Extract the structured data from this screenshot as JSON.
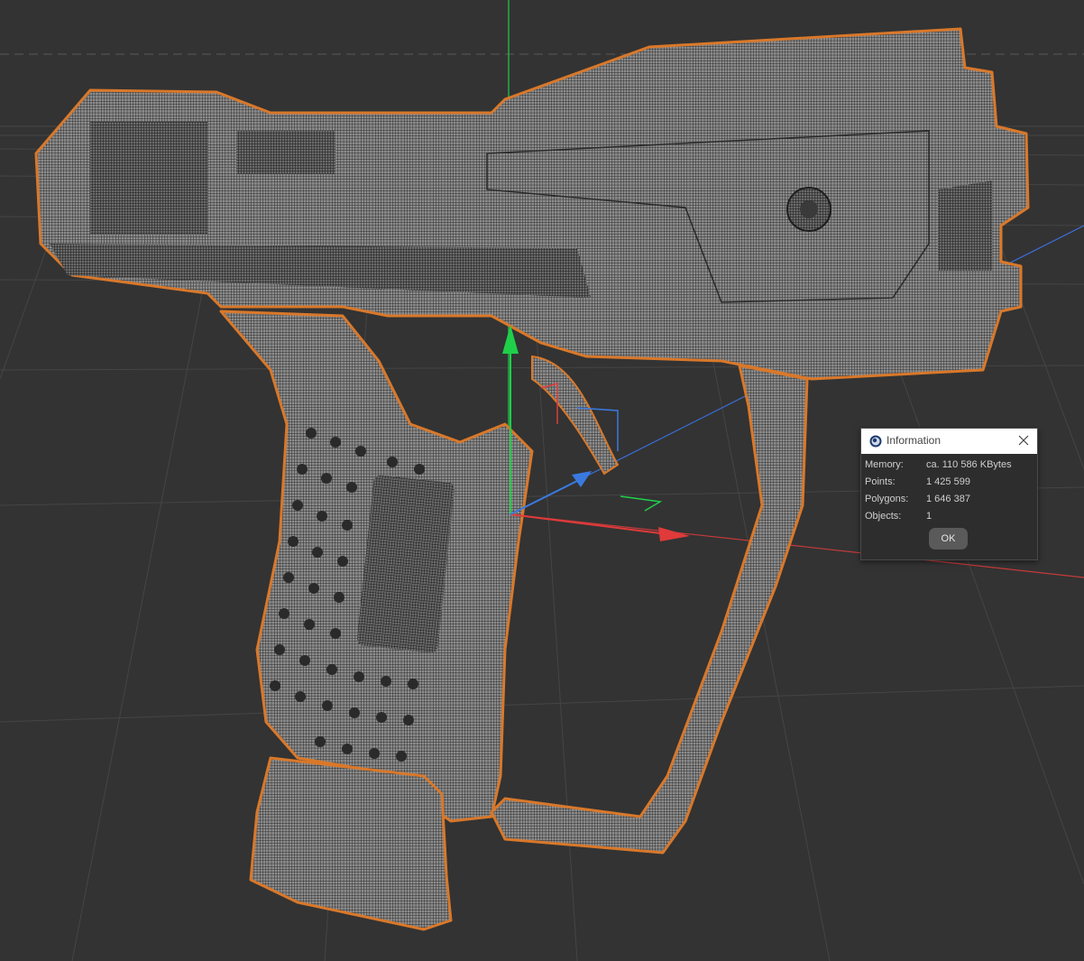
{
  "viewport": {
    "background": "#333333",
    "grid_color": "#444444",
    "axis_colors": {
      "x": "#d9383a",
      "y": "#1fcf4a",
      "z": "#3a6fd9"
    },
    "selection_outline": "#d9782a",
    "mesh_fill": "#8a8a8a"
  },
  "dialog": {
    "title": "Information",
    "icon": "cinema4d-icon",
    "rows": [
      {
        "label": "Memory:",
        "value": "ca. 110 586 KBytes"
      },
      {
        "label": "Points:",
        "value": "1 425 599"
      },
      {
        "label": "Polygons:",
        "value": "1 646 387"
      },
      {
        "label": "Objects:",
        "value": "1"
      }
    ],
    "ok_label": "OK"
  }
}
